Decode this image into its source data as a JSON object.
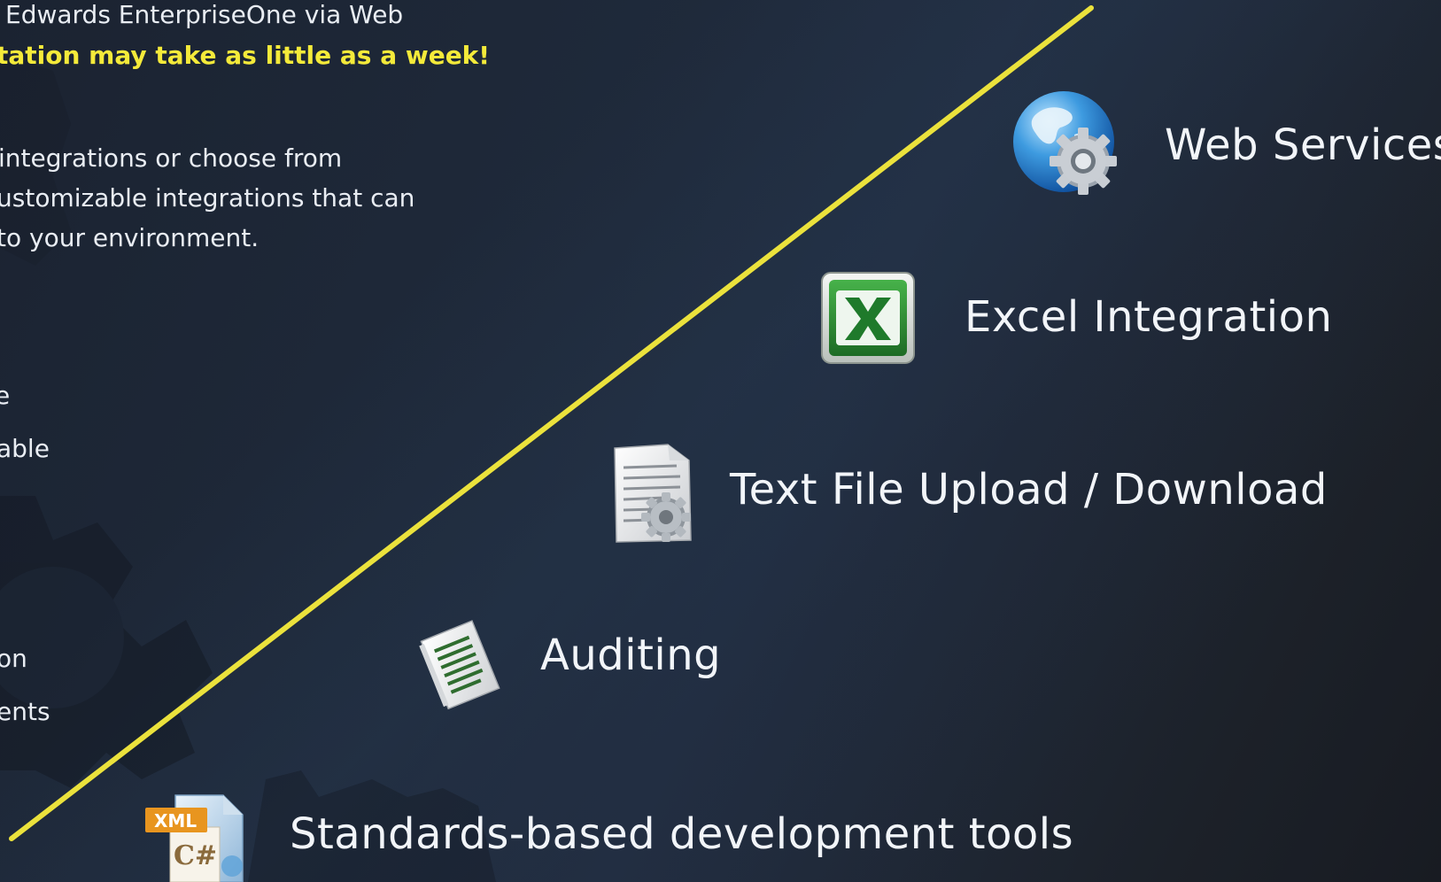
{
  "left_text": {
    "line1": "Edwards EnterpriseOne via Web",
    "line2": "tation may take as little as a week!",
    "line3": "integrations or choose from",
    "line4": "ustomizable integrations that can",
    "line5": " to your environment.",
    "line6": "e",
    "line7": "able",
    "line8": "on",
    "line9": "ents"
  },
  "features": [
    {
      "label": "Web Services",
      "icon": "globe-gear-icon"
    },
    {
      "label": "Excel Integration",
      "icon": "excel-icon"
    },
    {
      "label": "Text File Upload / Download",
      "icon": "text-file-gear-icon"
    },
    {
      "label": "Auditing",
      "icon": "audit-document-icon"
    },
    {
      "label": "Standards-based development tools",
      "icon": "xml-csharp-file-icon"
    }
  ],
  "icon_labels": {
    "xml": "XML",
    "csharp": "C#"
  },
  "colors": {
    "background": "#1c2230",
    "divider_line": "#ebe23c",
    "highlight_text": "#f4ea3a",
    "text": "#f2f5f9"
  }
}
